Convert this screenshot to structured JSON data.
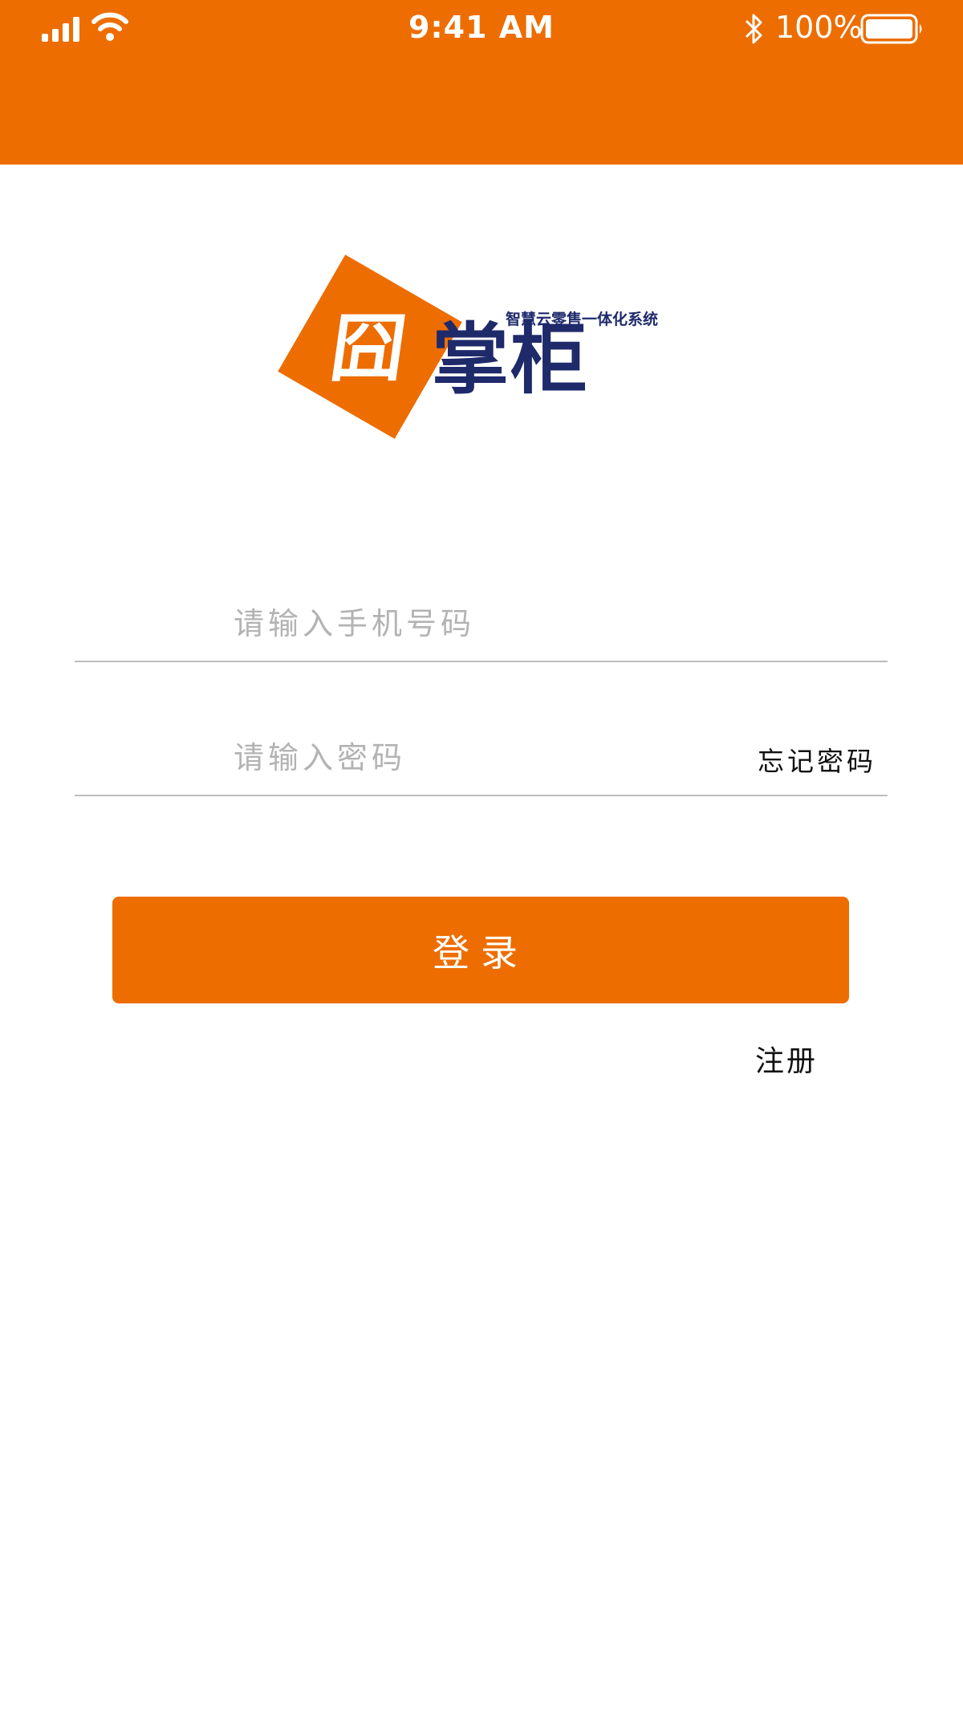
{
  "status_bar": {
    "time": "9:41 AM",
    "battery": "100%",
    "signal_icon": "cellular-signal-icon",
    "wifi_icon": "wifi-icon",
    "bluetooth_icon": "bluetooth-icon",
    "battery_icon": "battery-full-icon"
  },
  "colors": {
    "accent": "#ED6D00",
    "brand_navy": "#1F2A6B",
    "divider": "#BDBDBD",
    "placeholder": "#B3B3B3"
  },
  "logo": {
    "name": "掌柜",
    "tagline": "智慧云零售一体化系统"
  },
  "form": {
    "phone_placeholder": "请输入手机号码",
    "password_placeholder": "请输入密码",
    "forgot_label": "忘记密码",
    "login_label": "登录",
    "register_label": "注册"
  }
}
